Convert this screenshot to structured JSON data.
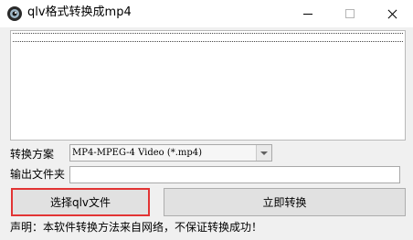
{
  "window": {
    "title": "qlv格式转换成mp4",
    "icon": "app-eye-icon"
  },
  "form": {
    "scheme_label": "转换方案",
    "scheme_value": "MP4-MPEG-4 Video (*.mp4)",
    "output_label": "输出文件夹",
    "output_value": ""
  },
  "buttons": {
    "select_label": "选择qlv文件",
    "convert_label": "立即转换"
  },
  "footer": {
    "statement": "声明：本软件转换方法来自网络，不保证转换成功！"
  },
  "colors": {
    "highlight_border": "#e23434"
  }
}
